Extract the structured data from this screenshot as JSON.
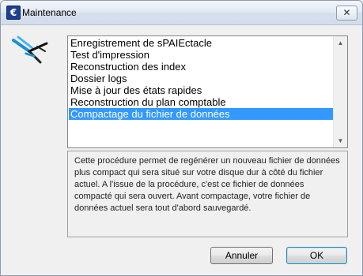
{
  "window": {
    "title": "Maintenance",
    "icon": "app-euro-icon",
    "close_glyph": "✕"
  },
  "list": {
    "items": [
      "Enregistrement de sPAIEctacle",
      "Test d'impression",
      "Reconstruction des index",
      "Dossier logs",
      "Mise à jour des états rapides",
      "Reconstruction du plan comptable",
      "Compactage du fichier de données"
    ],
    "selected_index": 6,
    "selection_color": "#3399ff"
  },
  "description": "Cette procédure permet de regénérer un nouveau fichier de données plus compact qui sera situé sur votre disque dur à côté du fichier actuel. A l'issue de la procédure, c'est ce fichier de données compacté qui sera ouvert. Avant compactage, votre fichier de données actuel sera tout d'abord sauvegardé.",
  "buttons": {
    "cancel": "Annuler",
    "ok": "OK"
  }
}
